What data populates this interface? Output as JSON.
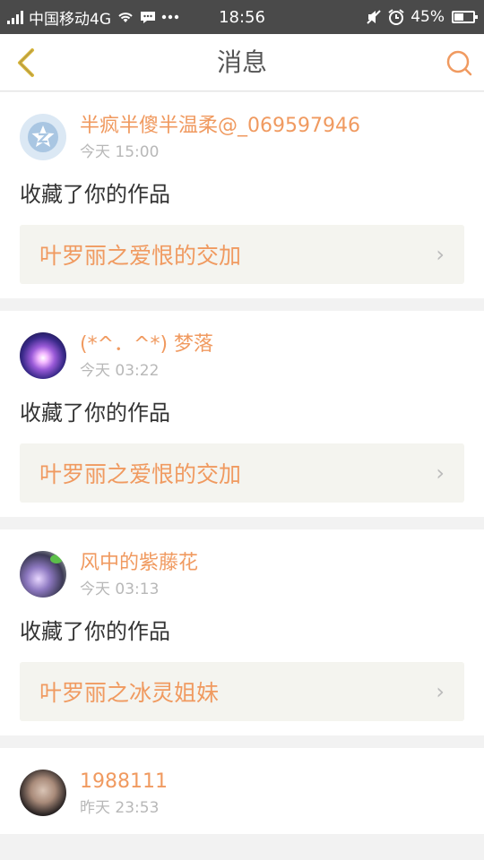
{
  "status_bar": {
    "carrier": "中国移动4G",
    "time": "18:56",
    "battery": "45%",
    "battery_level": 0.45
  },
  "navbar": {
    "title": "消息"
  },
  "messages": [
    {
      "username": "半疯半傻半温柔@_069597946",
      "time": "今天 15:00",
      "action": "收藏了你的作品",
      "work_title": "叶罗丽之爱恨的交加"
    },
    {
      "username": "(*^．^*) 梦落",
      "time": "今天 03:22",
      "action": "收藏了你的作品",
      "work_title": "叶罗丽之爱恨的交加"
    },
    {
      "username": "风中的紫藤花",
      "time": "今天 03:13",
      "action": "收藏了你的作品",
      "work_title": "叶罗丽之冰灵姐妹"
    },
    {
      "username": "1988111",
      "time": "昨天 23:53"
    }
  ],
  "colors": {
    "accent": "#f09a60",
    "back_icon": "#d8b63c",
    "status_bar_bg": "#4a4a4a"
  },
  "icons": [
    "signal-icon",
    "wifi-icon",
    "chat-icon",
    "mute-icon",
    "alarm-icon",
    "battery-icon",
    "back-arrow-icon",
    "search-icon",
    "chevron-right-icon"
  ]
}
